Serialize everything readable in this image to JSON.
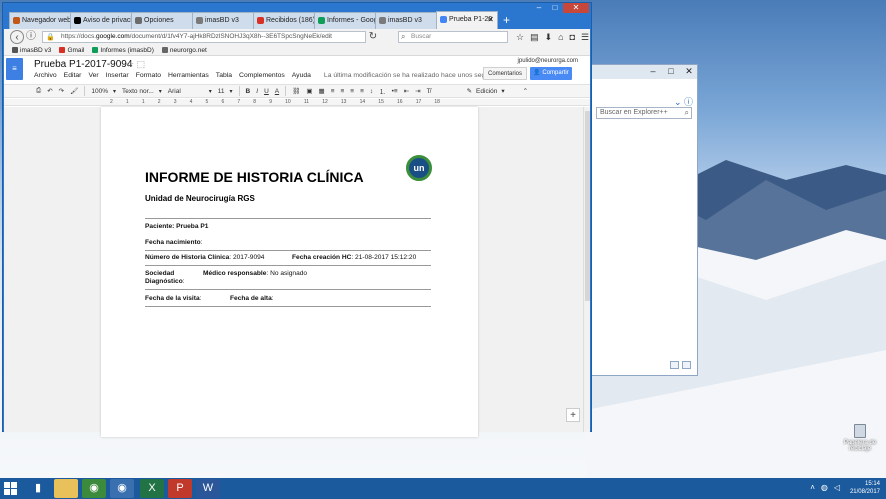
{
  "browser": {
    "tabs": [
      {
        "label": "Navegador web",
        "color": "#c2571a"
      },
      {
        "label": "Aviso de privacid",
        "color": "#000000"
      },
      {
        "label": "Opciones",
        "color": "#6b6b6b"
      },
      {
        "label": "imasBD v3",
        "color": "#7a7a7a"
      },
      {
        "label": "Recibidos (186)",
        "color": "#d93025"
      },
      {
        "label": "Informes - Goog",
        "color": "#0f9d58"
      },
      {
        "label": "imasBD v3",
        "color": "#7a7a7a"
      },
      {
        "label": "Prueba P1-20",
        "color": "#4285f4"
      }
    ],
    "new_tab": "+",
    "url_prefix": "https://docs.",
    "url_domain": "google.com",
    "url_rest": "/document/d/1fv4Y7-ajHk8RDzlSNOHJ3qX8h--3E6TSpcSngNeEk/edit",
    "search_placeholder": "Buscar",
    "bookmarks": [
      "imasBD v3",
      "Gmail",
      "Informes (imasbD)",
      "neurorgo.net"
    ]
  },
  "docs": {
    "title": "Prueba P1-2017-9094",
    "menu": [
      "Archivo",
      "Editar",
      "Ver",
      "Insertar",
      "Formato",
      "Herramientas",
      "Tabla",
      "Complementos",
      "Ayuda"
    ],
    "last_modified": "La última modificación se ha realizado hace unos segundos",
    "user": "jpulido@neurorga.com",
    "comments_button": "Comentarios",
    "share_button": "Compartir",
    "toolbar": {
      "zoom": "100%",
      "style": "Texto nor...",
      "font": "Arial",
      "size": "11",
      "mode": "Edición"
    },
    "ruler": [
      "2",
      "1",
      "1",
      "2",
      "3",
      "4",
      "5",
      "6",
      "7",
      "8",
      "9",
      "10",
      "11",
      "12",
      "13",
      "14",
      "15",
      "16",
      "17",
      "18"
    ]
  },
  "document": {
    "title": "INFORME DE HISTORIA CLÍNICA",
    "subtitle": "Unidad de Neurocirugía RGS",
    "logo_text": "un",
    "paciente_label": "Paciente: Prueba P1",
    "fecha_nacimiento_label": "Fecha nacimiento",
    "nhc_label": "Número de Historia Clínica",
    "nhc_value": ": 2017-9094",
    "fecha_creacion_label": "Fecha creación HC",
    "fecha_creacion_value": ": 21-08-2017 15:12:20",
    "sociedad_label": "Sociedad",
    "medico_label": "Médico responsable",
    "medico_value": ": No asignado",
    "diagnostico_label": "Diagnóstico",
    "fecha_visita_label": "Fecha de la visita",
    "fecha_alta_label": "Fecha de alta"
  },
  "ie": {
    "search_placeholder": "Buscar en Explorer++"
  },
  "desktop": {
    "recycle_bin": "Papelera de reciclaje",
    "time": "15:14",
    "date": "21/08/2017"
  }
}
